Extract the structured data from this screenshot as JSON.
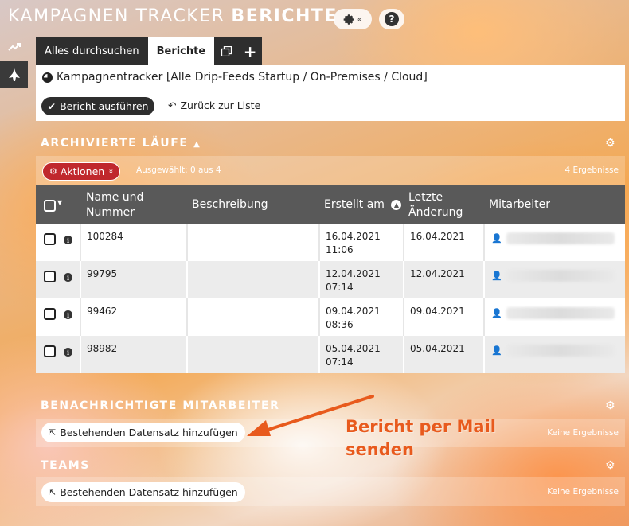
{
  "app": {
    "title_light": "KAMPAGNEN TRACKER",
    "title_bold": "BERICHTE"
  },
  "topbar": {
    "settings_icon": "gear-icon",
    "settings_caret": "»",
    "help_label": "?"
  },
  "sidebar": {
    "items": [
      {
        "icon": "trend-icon"
      },
      {
        "icon": "rocket-icon"
      }
    ]
  },
  "tabs": {
    "search_label": "Alles durchsuchen",
    "reports_label": "Berichte",
    "new_window_icon": "copy-icon",
    "add_icon": "plus-icon",
    "add_label": "+"
  },
  "report": {
    "title": "Kampagnentracker [Alle Drip-Feeds Startup / On-Premises / Cloud]",
    "run_label": "Bericht ausführen",
    "back_label": "Zurück zur Liste"
  },
  "archived": {
    "title": "ARCHIVIERTE LÄUFE",
    "actions_label": "Aktionen",
    "selected_text": "Ausgewählt: 0 aus 4",
    "results_text": "4 Ergebnisse",
    "columns": {
      "name": "Name und Nummer",
      "description": "Beschreibung",
      "created": "Erstellt am",
      "modified": "Letzte Änderung",
      "employee": "Mitarbeiter"
    },
    "rows": [
      {
        "number": "100284",
        "description": "",
        "created_date": "16.04.2021",
        "created_time": "11:06",
        "modified": "16.04.2021"
      },
      {
        "number": "99795",
        "description": "",
        "created_date": "12.04.2021",
        "created_time": "07:14",
        "modified": "12.04.2021"
      },
      {
        "number": "99462",
        "description": "",
        "created_date": "09.04.2021",
        "created_time": "08:36",
        "modified": "09.04.2021"
      },
      {
        "number": "98982",
        "description": "",
        "created_date": "05.04.2021",
        "created_time": "07:14",
        "modified": "05.04.2021"
      }
    ]
  },
  "notified": {
    "title": "BENACHRICHTIGTE MITARBEITER",
    "add_label": "Bestehenden Datensatz hinzufügen",
    "results_text": "Keine Ergebnisse"
  },
  "teams": {
    "title": "TEAMS",
    "add_label": "Bestehenden Datensatz hinzufügen",
    "results_text": "Keine Ergebnisse"
  },
  "annotation": {
    "line1": "Bericht per Mail",
    "line2": "senden",
    "color": "#e85a1d"
  }
}
